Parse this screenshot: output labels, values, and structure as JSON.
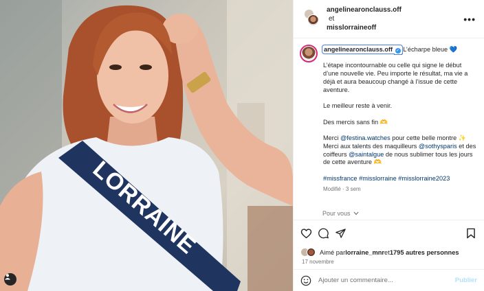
{
  "header": {
    "author": "angelinearonclauss.off",
    "joiner": "et",
    "coauthor": "misslorraineoff",
    "more_label": "•••"
  },
  "photo": {
    "sash_text": "LORRAINE"
  },
  "caption": {
    "username": "angelinearonclauss.off",
    "title": "L’écharpe bleue 💙",
    "p1": "L’étape incontournable ou celle qui signe le début d’une nouvelle vie. Peu importe le résultat, ma vie a déjà et aura beaucoup changé à l’issue de cette aventure.",
    "p2": "Le meilleur reste à venir.",
    "p3": "Des mercis sans fin 🫶",
    "p4_a": "Merci ",
    "p4_mention1": "@festina.watches",
    "p4_b": " pour cette belle montre ✨ Merci aux talents des maquilleurs ",
    "p4_mention2": "@sothysparis",
    "p4_c": " et des coiffeurs ",
    "p4_mention3": "@saintalgue",
    "p4_d": " de nous sublimer tous les jours de cette aventure 🫶",
    "hashtags": "#missfrance #misslorraine #misslorraine2023",
    "meta": "Modifié · 3 sem"
  },
  "more_replies": "Pour vous",
  "likes": {
    "prefix": "Aimé par ",
    "user": "lorraine_mnr",
    "middle": " et ",
    "count": "1795 autres personnes"
  },
  "date": "17 novembre",
  "comment_input": {
    "placeholder": "Ajouter un commentaire..."
  },
  "publish_label": "Publier",
  "colors": {
    "link": "#00376b",
    "verified": "#3897f0",
    "publish_disabled": "#b2dffc",
    "sash": "#1f3560"
  }
}
